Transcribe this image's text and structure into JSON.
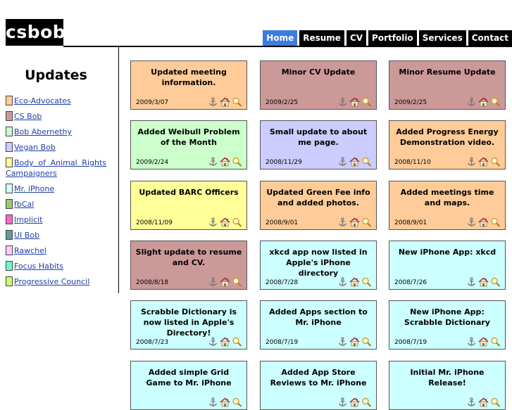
{
  "site": {
    "logo": "csbob"
  },
  "nav": [
    {
      "label": "Home",
      "active": true
    },
    {
      "label": "Resume"
    },
    {
      "label": "CV"
    },
    {
      "label": "Portfolio"
    },
    {
      "label": "Services"
    },
    {
      "label": "Contact"
    }
  ],
  "sidebar": {
    "title": "Updates",
    "links": [
      {
        "label": "Eco-Advocates",
        "color": "#ffcc99"
      },
      {
        "label": "CS Bob",
        "color": "#cc9999"
      },
      {
        "label": "Bob Abernethy",
        "color": "#ccffcc"
      },
      {
        "label": "Vegan Bob",
        "color": "#ccccff"
      },
      {
        "label": "Body of Animal Rights Campaigners",
        "color": "#ffff99"
      },
      {
        "label": "Mr. iPhone",
        "color": "#ccffff"
      },
      {
        "label": "fbCal",
        "color": "#99cc66"
      },
      {
        "label": "Implicit",
        "color": "#ff66cc"
      },
      {
        "label": "UI Bob",
        "color": "#669999"
      },
      {
        "label": "Rawchel",
        "color": "#ffccff"
      },
      {
        "label": "Focus Habits",
        "color": "#66ffcc"
      },
      {
        "label": "Progressive Council",
        "color": "#ccff66"
      }
    ]
  },
  "updates": [
    {
      "title": "Updated meeting information.",
      "date": "2009/3/07",
      "color": "#ffcc99"
    },
    {
      "title": "Minor CV Update",
      "date": "2009/2/25",
      "color": "#cc9999"
    },
    {
      "title": "Minor Resume Update",
      "date": "2009/2/25",
      "color": "#cc9999"
    },
    {
      "title": "Added Weibull Problem of the Month",
      "date": "2009/2/24",
      "color": "#ccffcc"
    },
    {
      "title": "Small update to about me page.",
      "date": "2008/11/29",
      "color": "#ccccff"
    },
    {
      "title": "Added Progress Energy Demonstration video.",
      "date": "2008/11/10",
      "color": "#ffcc99"
    },
    {
      "title": "Updated BARC Officers",
      "date": "2008/11/09",
      "color": "#ffff99"
    },
    {
      "title": "Updated Green Fee info and added photos.",
      "date": "2008/9/01",
      "color": "#ffcc99"
    },
    {
      "title": "Added meetings time and maps.",
      "date": "2008/9/01",
      "color": "#ffcc99"
    },
    {
      "title": "Slight update to resume and CV.",
      "date": "2008/8/18",
      "color": "#cc9999"
    },
    {
      "title": "xkcd app now listed in Apple's iPhone directory",
      "date": "2008/7/28",
      "color": "#ccffff"
    },
    {
      "title": "New iPhone App: xkcd",
      "date": "2008/7/26",
      "color": "#ccffff"
    },
    {
      "title": "Scrabble Dictionary is now listed in Apple's Directory!",
      "date": "2008/7/23",
      "color": "#ccffff"
    },
    {
      "title": "Added Apps section to Mr. iPhone",
      "date": "2008/7/19",
      "color": "#ccffff"
    },
    {
      "title": "New iPhone App: Scrabble Dictionary",
      "date": "2008/7/19",
      "color": "#ccffff"
    },
    {
      "title": "Added simple Grid Game to Mr. iPhone",
      "date": "",
      "color": "#ccffff"
    },
    {
      "title": "Added App Store Reviews to Mr. iPhone",
      "date": "",
      "color": "#ccffff"
    },
    {
      "title": "Initial Mr. iPhone Release!",
      "date": "",
      "color": "#ccffff"
    }
  ],
  "icons": [
    "anchor-icon",
    "home-icon",
    "magnifier-icon"
  ]
}
